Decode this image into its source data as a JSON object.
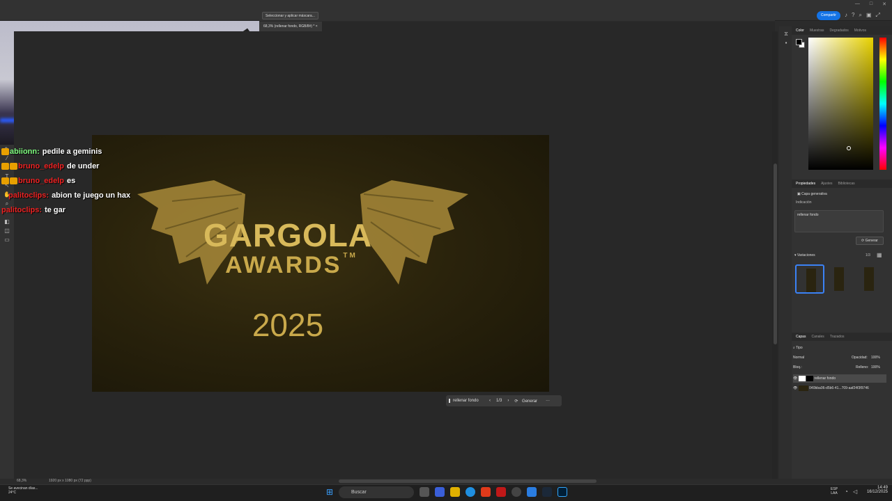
{
  "app": {
    "share_label": "Compartir",
    "options_button": "Seleccionar y aplicar máscara...",
    "doc_tab": "68,3% (rellenar fondo, RGB/8#) *"
  },
  "artwork": {
    "line1": "GARGOLA",
    "line2": "AWARDS",
    "tm": "TM",
    "year": "2025"
  },
  "generative_taskbar": {
    "prompt": "rellenar fondo",
    "counter": "1/3",
    "generate": "Generar",
    "more": "···"
  },
  "chat": [
    {
      "user": "abiionn:",
      "text": "pedile a geminis",
      "user_color": "#7fff7f"
    },
    {
      "user": "bruno_edelp",
      "text": "de under",
      "user_color": "#e22"
    },
    {
      "user": "bruno_edelp",
      "text": "es",
      "user_color": "#e22"
    },
    {
      "user": "palitoclips:",
      "text": "abion te juego un hax",
      "user_color": "#e22"
    },
    {
      "user": "palitoclips:",
      "text": "te gar",
      "user_color": "#e22"
    }
  ],
  "color_panel": {
    "tabs": [
      "Color",
      "Muestras",
      "Degradados",
      "Motivos"
    ]
  },
  "properties_panel": {
    "tabs": [
      "Propiedades",
      "Ajustes",
      "Bibliotecas"
    ],
    "layer_type": "Capa generativa",
    "prompt_label": "Indicación",
    "prompt": "rellenar fondo",
    "generate": "Generar",
    "variations": "Variaciones",
    "var_counter": "1/3"
  },
  "layers_panel": {
    "tabs": [
      "Capas",
      "Canales",
      "Trazados"
    ],
    "filter": "Tipo",
    "blend": "Normal",
    "opacity_label": "Opacidad:",
    "opacity": "100%",
    "lock_label": "Bloq.:",
    "fill_label": "Relleno:",
    "fill": "100%",
    "layers": [
      "rellenar fondo",
      "040bba06-d5b6-41...709-aaf24f3f9746"
    ]
  },
  "status": {
    "zoom": "68,3%",
    "size": "1920 px x 1080 px (72 ppp)"
  },
  "taskbar": {
    "search": "Buscar",
    "weather": "Se avecinan días...",
    "temp": "24°C",
    "lang1": "ESP",
    "lang2": "LAA",
    "time": "14:49",
    "date": "16/12/2025"
  },
  "colors": {
    "accent": "#1473e6",
    "brand_gold": "#d8b95a"
  }
}
